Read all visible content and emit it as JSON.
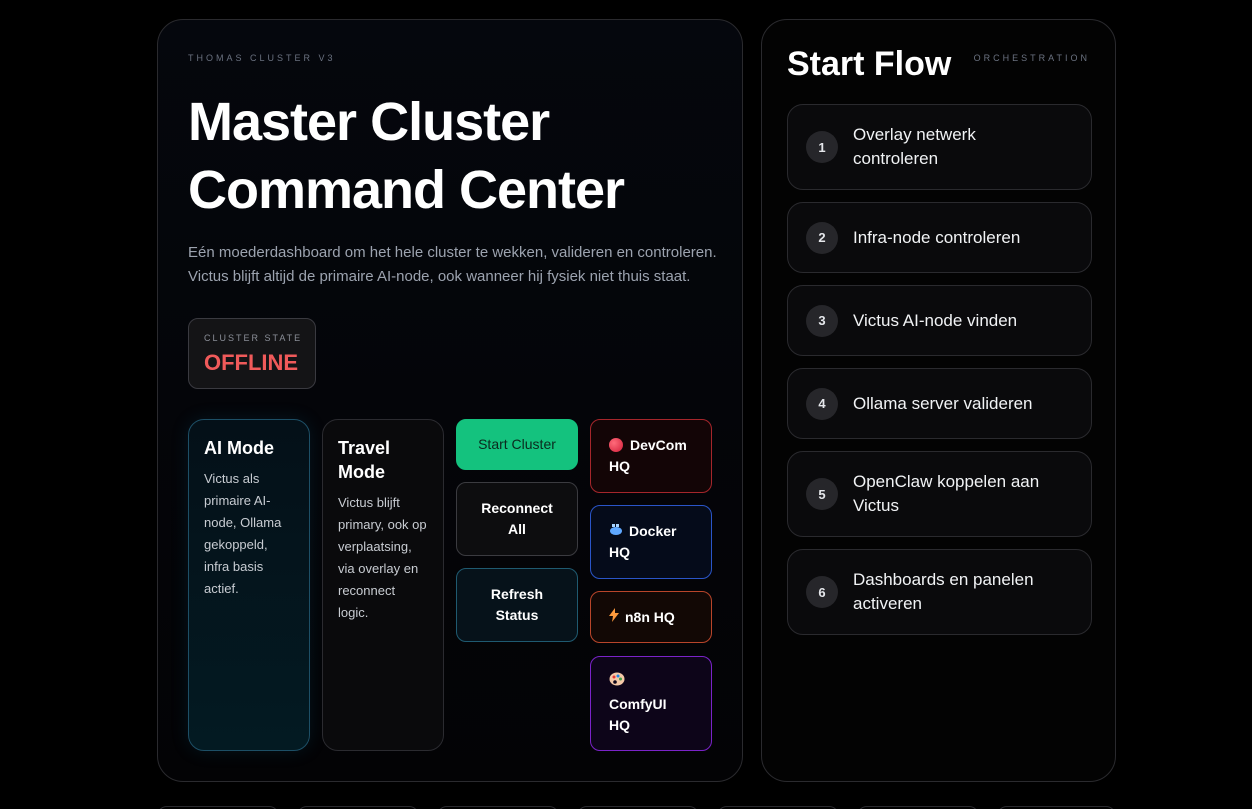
{
  "main": {
    "eyebrow": "THOMAS CLUSTER V3",
    "title_line1": "Master Cluster",
    "title_line2": "Command Center",
    "desc_line1": "Eén moederdashboard om het hele cluster te wekken, valideren en controleren.",
    "desc_line2": "Victus blijft altijd de primaire AI-node, ook wanneer hij fysiek niet thuis staat.",
    "state_label": "CLUSTER STATE",
    "state_value": "OFFLINE"
  },
  "modes": {
    "ai": {
      "title": "AI Mode",
      "text": "Victus als primaire AI-node, Ollama gekoppeld, infra basis actief."
    },
    "travel": {
      "title": "Travel Mode",
      "text": "Victus blijft primary, ook op verplaatsing, via overlay en reconnect logic."
    }
  },
  "actions": {
    "start": "Start Cluster",
    "reconnect": "Reconnect All",
    "refresh": "Refresh Status"
  },
  "hq": {
    "devcom": {
      "label": "DevCom HQ",
      "icon": "red-circle-icon"
    },
    "docker": {
      "label": "Docker HQ",
      "icon": "whale-icon"
    },
    "n8n": {
      "label": "n8n HQ",
      "icon": "lightning-icon"
    },
    "comfy": {
      "label": "ComfyUI HQ",
      "icon": "palette-icon"
    }
  },
  "flow": {
    "title": "Start Flow",
    "eyebrow": "ORCHESTRATION",
    "steps": [
      {
        "num": "1",
        "label": "Overlay netwerk controleren"
      },
      {
        "num": "2",
        "label": "Infra-node controleren"
      },
      {
        "num": "3",
        "label": "Victus AI-node vinden"
      },
      {
        "num": "4",
        "label": "Ollama server valideren"
      },
      {
        "num": "5",
        "label": "OpenClaw koppelen aan Victus"
      },
      {
        "num": "6",
        "label": "Dashboards en panelen activeren"
      }
    ]
  },
  "colors": {
    "accent_green": "#14c27e",
    "offline_red": "#f05a5a",
    "devcom_border": "#a5262b",
    "docker_border": "#2a55c8",
    "n8n_border": "#b8452a",
    "comfy_border": "#7a23c8"
  }
}
